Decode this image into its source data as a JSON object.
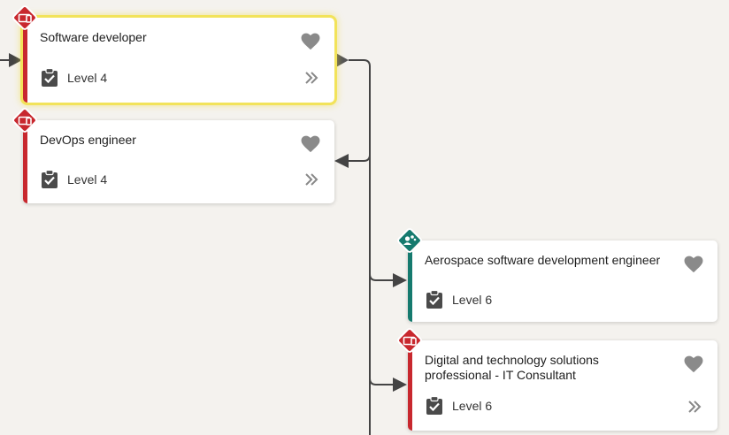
{
  "colors": {
    "red": "#c8282e",
    "teal": "#157a6e",
    "connector": "#444444",
    "selected_border": "#f2e35a"
  },
  "cards": [
    {
      "title": "Software developer",
      "level": "Level 4",
      "icon": "digital-device-icon",
      "accent": "red",
      "selected": true
    },
    {
      "title": "DevOps engineer",
      "level": "Level 4",
      "icon": "digital-device-icon",
      "accent": "red",
      "selected": false
    },
    {
      "title": "Aerospace software development engineer",
      "level": "Level 6",
      "icon": "people-group-icon",
      "accent": "teal",
      "selected": false
    },
    {
      "title": "Digital and technology solutions professional - IT Consultant",
      "level": "Level 6",
      "icon": "digital-device-icon",
      "accent": "red",
      "selected": false
    }
  ]
}
